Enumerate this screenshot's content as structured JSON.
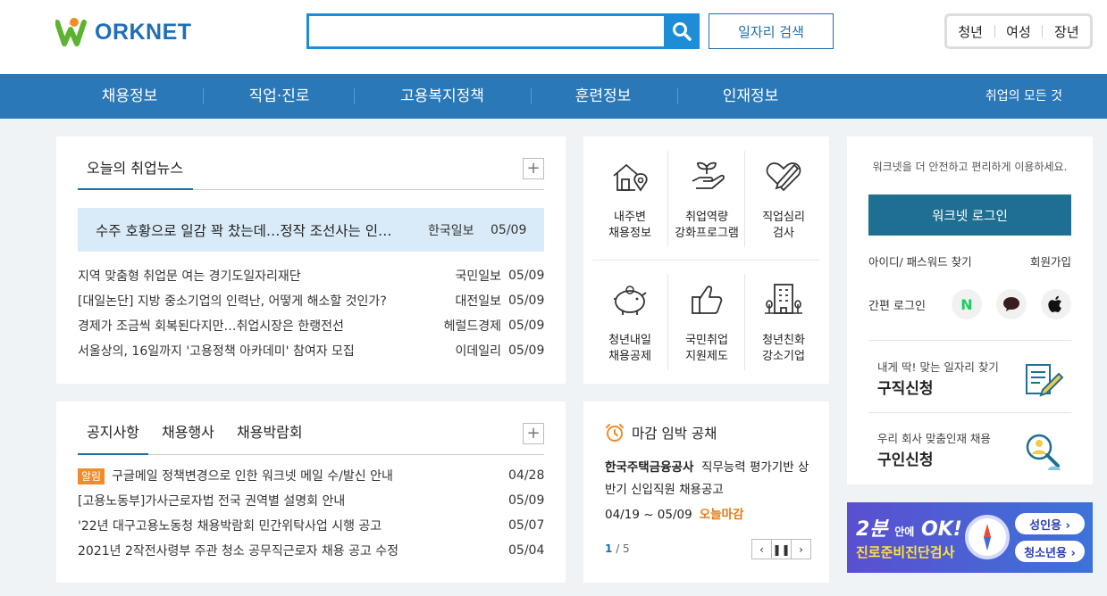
{
  "header": {
    "logo_text": "ORKNET",
    "search_placeholder": "",
    "job_search_label": "일자리 검색",
    "audience": [
      "청년",
      "여성",
      "장년"
    ]
  },
  "nav": {
    "items": [
      "채용정보",
      "직업·진로",
      "고용복지정책",
      "훈련정보",
      "인재정보"
    ],
    "right": "취업의 모든 것"
  },
  "news": {
    "tab": "오늘의 취업뉴스",
    "highlight": {
      "title": "수주 호황으로 일감 꽉 찼는데…정작 조선사는 인…",
      "source": "한국일보",
      "date": "05/09"
    },
    "items": [
      {
        "title": "지역 맞춤형 취업문 여는 경기도일자리재단",
        "source": "국민일보",
        "date": "05/09"
      },
      {
        "title": "[대일논단] 지방 중소기업의 인력난, 어떻게 해소할 것인가?",
        "source": "대전일보",
        "date": "05/09"
      },
      {
        "title": "경제가 조금씩 회복된다지만…취업시장은 한랭전선",
        "source": "헤럴드경제",
        "date": "05/09"
      },
      {
        "title": "서울상의, 16일까지 '고용정책 아카데미' 참여자 모집",
        "source": "이데일리",
        "date": "05/09"
      }
    ]
  },
  "services": [
    {
      "label1": "내주변",
      "label2": "채용정보",
      "icon": "house-location-icon"
    },
    {
      "label1": "취업역량",
      "label2": "강화프로그램",
      "icon": "hand-sprout-icon"
    },
    {
      "label1": "직업심리",
      "label2": "검사",
      "icon": "heart-pen-icon"
    },
    {
      "label1": "청년내일",
      "label2": "채용공제",
      "icon": "piggy-bank-icon"
    },
    {
      "label1": "국민취업",
      "label2": "지원제도",
      "icon": "thumbs-up-icon"
    },
    {
      "label1": "청년친화",
      "label2": "강소기업",
      "icon": "building-icon"
    }
  ],
  "login": {
    "note": "워크넷을 더 안전하고 편리하게 이용하세요.",
    "button": "워크넷 로그인",
    "find": "아이디/ 패스워드 찾기",
    "join": "회원가입",
    "easy": "간편 로그인",
    "job_seek_small": "내게 딱! 맞는 일자리 찾기",
    "job_seek_big": "구직신청",
    "recruit_small": "우리 회사 맞춤인재 채용",
    "recruit_big": "구인신청"
  },
  "notice": {
    "tabs": [
      "공지사항",
      "채용행사",
      "채용박람회"
    ],
    "badge": "알림",
    "items": [
      {
        "title": "구글메일 정책변경으로 인한 워크넷 메일 수/발신 안내",
        "date": "04/28"
      },
      {
        "title": "[고용노동부]가사근로자법 전국 권역별 설명회 안내",
        "date": "05/09"
      },
      {
        "title": "'22년 대구고용노동청 채용박람회 민간위탁사업 시행 공고",
        "date": "05/07"
      },
      {
        "title": "2021년 2작전사령부 주관 청소 공무직근로자 채용 공고 수정",
        "date": "05/04"
      }
    ]
  },
  "deadline": {
    "title": "마감 임박 공채",
    "company": "한국주택금융공사",
    "desc": "직무능력 평가기반 상반기 신입직원 채용공고",
    "period": "04/19 ~ 05/09",
    "today": "오늘마감",
    "page_current": "1",
    "page_total": "/ 5"
  },
  "banner": {
    "line1_big": "2분",
    "line1_small": "안에",
    "line1_ok": "OK!",
    "line2": "진로준비진단검사",
    "pill_adult": "성인용 ›",
    "pill_youth": "청소년용 ›"
  },
  "colors": {
    "brand": "#2a78b8",
    "search": "#1d8ed6",
    "accent": "#f08c2a"
  }
}
